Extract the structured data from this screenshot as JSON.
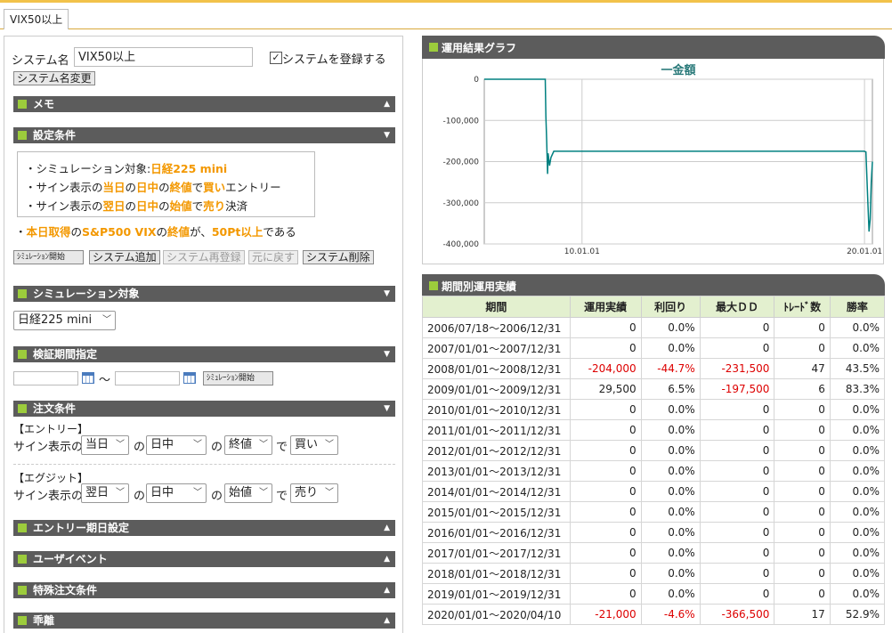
{
  "tab": {
    "label": "VIX50以上"
  },
  "system": {
    "name_label": "システム名",
    "name_value": "VIX50以上",
    "register_label": "システムを登録する",
    "rename_button": "システム名変更"
  },
  "sections": {
    "memo": "メモ",
    "settings": "設定条件",
    "sim_target": "シミュレーション対象",
    "period": "検証期間指定",
    "order": "注文条件",
    "entry_date": "エントリー期日設定",
    "user_event": "ユーザイベント",
    "special_order": "特殊注文条件",
    "divergence": "乖離"
  },
  "conditions": {
    "line1": {
      "a": "・シミュレーション対象:",
      "b": "日経225 mini"
    },
    "line2": {
      "a": "・サイン表示の",
      "b": "当日",
      "c": "の",
      "d": "日中",
      "e": "の",
      "f": "終値",
      "g": "で",
      "h": "買い",
      "i": "エントリー"
    },
    "line3": {
      "a": "・サイン表示の",
      "b": "翌日",
      "c": "の",
      "d": "日中",
      "e": "の",
      "f": "始値",
      "g": "で",
      "h": "売り",
      "i": "決済"
    },
    "rule": {
      "a": "・",
      "b": "本日取得",
      "c": "の",
      "d": "S&P500 VIX",
      "e": "の",
      "f": "終値",
      "g": "が、",
      "h": "50Pt以上",
      "i": "である"
    }
  },
  "buttons": {
    "sim_start": "ｼﾐｭﾚｰｼｮﾝ開始",
    "add": "システム追加",
    "reregister": "システム再登録",
    "revert": "元に戻す",
    "delete": "システム削除",
    "sim_start2": "ｼﾐｭﾚｰｼｮﾝ開始"
  },
  "sim_target_select": "日経225 mini",
  "period": {
    "tilde": "～"
  },
  "order": {
    "entry_label": "【エントリー】",
    "exit_label": "【エグジット】",
    "sign_label": "サイン表示の",
    "no": "の",
    "de": "で",
    "entry": {
      "day": "当日",
      "session": "日中",
      "price": "終値",
      "side": "買い"
    },
    "exit": {
      "day": "翌日",
      "session": "日中",
      "price": "始値",
      "side": "売り"
    }
  },
  "graph": {
    "title": "運用結果グラフ",
    "legend": "一金額",
    "color": "#008080"
  },
  "chart_data": {
    "type": "line",
    "title": "",
    "xlabel": "",
    "ylabel": "",
    "series": [
      {
        "name": "金額",
        "x": [
          2006.54,
          2008.7,
          2008.72,
          2008.75,
          2008.78,
          2008.8,
          2008.85,
          2008.9,
          2009.0,
          2009.3,
          2010.0,
          2015.0,
          2019.99,
          2020.05,
          2020.12,
          2020.16,
          2020.2,
          2020.24,
          2020.28
        ],
        "y": [
          0,
          0,
          -90000,
          -150000,
          -230000,
          -180000,
          -210000,
          -190000,
          -175000,
          -175000,
          -175000,
          -175000,
          -175000,
          -176500,
          -300000,
          -370000,
          -340000,
          -250000,
          -200000
        ]
      }
    ],
    "x_ticks": [
      "10.01.01",
      "20.01.01"
    ],
    "y_ticks": [
      "0",
      "-100,000",
      "-200,000",
      "-300,000",
      "-400,000"
    ],
    "xlim": [
      2006.54,
      2020.28
    ],
    "ylim": [
      -400000,
      0
    ],
    "grid": true
  },
  "results": {
    "title": "期間別運用実績",
    "headers": [
      "期間",
      "運用実績",
      "利回り",
      "最大ＤＤ",
      "ﾄﾚｰﾄﾞ数",
      "勝率"
    ],
    "rows": [
      [
        "2006/07/18～2006/12/31",
        "0",
        "0.0%",
        "0",
        "0",
        "0.0%"
      ],
      [
        "2007/01/01～2007/12/31",
        "0",
        "0.0%",
        "0",
        "0",
        "0.0%"
      ],
      [
        "2008/01/01～2008/12/31",
        "-204,000",
        "-44.7%",
        "-231,500",
        "47",
        "43.5%"
      ],
      [
        "2009/01/01～2009/12/31",
        "29,500",
        "6.5%",
        "-197,500",
        "6",
        "83.3%"
      ],
      [
        "2010/01/01～2010/12/31",
        "0",
        "0.0%",
        "0",
        "0",
        "0.0%"
      ],
      [
        "2011/01/01～2011/12/31",
        "0",
        "0.0%",
        "0",
        "0",
        "0.0%"
      ],
      [
        "2012/01/01～2012/12/31",
        "0",
        "0.0%",
        "0",
        "0",
        "0.0%"
      ],
      [
        "2013/01/01～2013/12/31",
        "0",
        "0.0%",
        "0",
        "0",
        "0.0%"
      ],
      [
        "2014/01/01～2014/12/31",
        "0",
        "0.0%",
        "0",
        "0",
        "0.0%"
      ],
      [
        "2015/01/01～2015/12/31",
        "0",
        "0.0%",
        "0",
        "0",
        "0.0%"
      ],
      [
        "2016/01/01～2016/12/31",
        "0",
        "0.0%",
        "0",
        "0",
        "0.0%"
      ],
      [
        "2017/01/01～2017/12/31",
        "0",
        "0.0%",
        "0",
        "0",
        "0.0%"
      ],
      [
        "2018/01/01～2018/12/31",
        "0",
        "0.0%",
        "0",
        "0",
        "0.0%"
      ],
      [
        "2019/01/01～2019/12/31",
        "0",
        "0.0%",
        "0",
        "0",
        "0.0%"
      ],
      [
        "2020/01/01～2020/04/10",
        "-21,000",
        "-4.6%",
        "-366,500",
        "17",
        "52.9%"
      ]
    ]
  },
  "icons": {
    "collapse": "▲",
    "expand": "▼",
    "chev": "﹀",
    "check": "✓"
  }
}
